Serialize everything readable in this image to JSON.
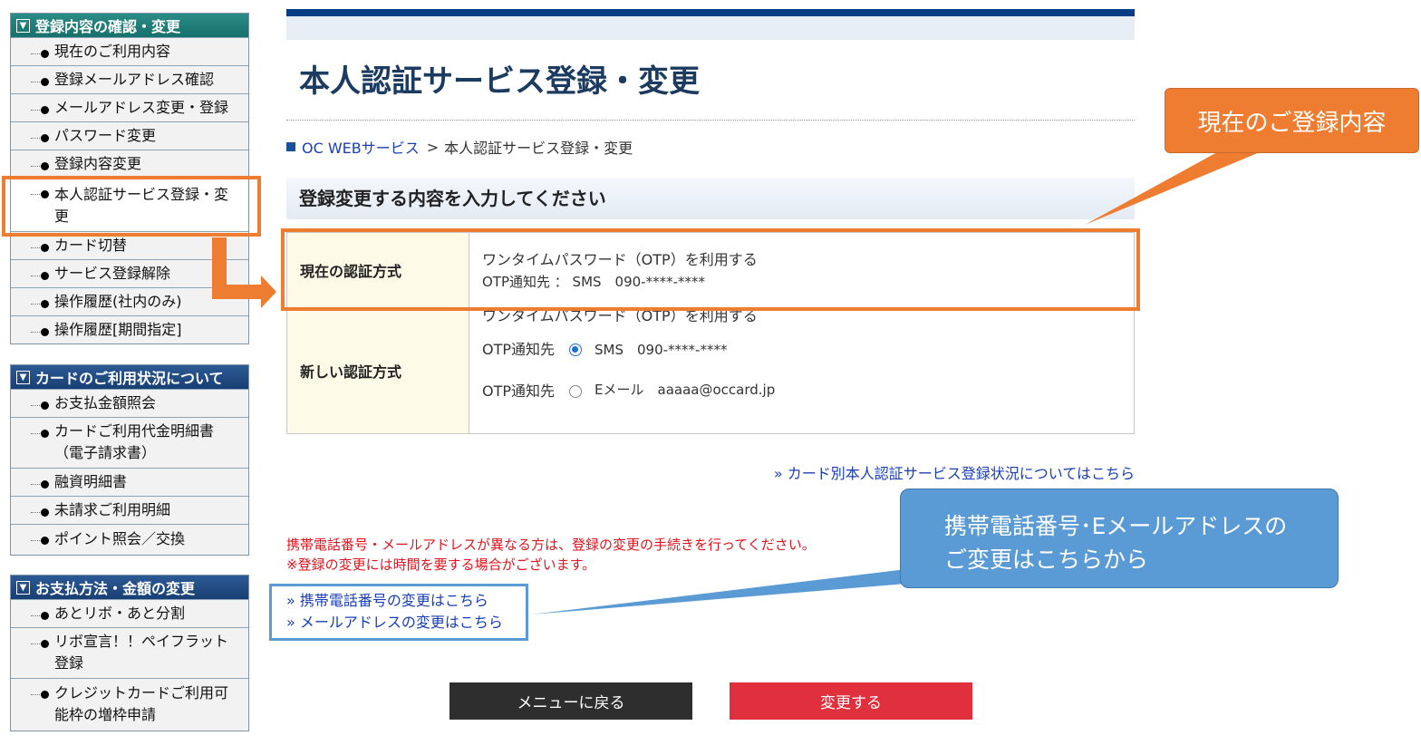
{
  "sidebar": {
    "menus": [
      {
        "title": "登録内容の確認・変更",
        "items": [
          "現在のご利用内容",
          "登録メールアドレス確認",
          "メールアドレス変更・登録",
          "パスワード変更",
          "登録内容変更",
          "本人認証サービス登録・変更",
          "カード切替",
          "サービス登録解除",
          "操作履歴(社内のみ)",
          "操作履歴[期間指定]"
        ]
      },
      {
        "title": "カードのご利用状況について",
        "items": [
          "お支払金額照会",
          "カードご利用代金明細書（電子請求書）",
          "融資明細書",
          "未請求ご利用明細",
          "ポイント照会／交換"
        ]
      },
      {
        "title": "お支払方法・金額の変更",
        "items": [
          "あとリボ・あと分割",
          "リボ宣言！！ペイフラット登録",
          "クレジットカードご利用可能枠の増枠申請"
        ]
      }
    ]
  },
  "main": {
    "title": "本人認証サービス登録・変更",
    "breadcrumb": {
      "root": "OC WEBサービス",
      "separator": ">",
      "current": "本人認証サービス登録・変更"
    },
    "section_title": "登録変更する内容を入力してください",
    "current_method": {
      "label": "現在の認証方式",
      "line1": "ワンタイムパスワード（OTP）を利用する",
      "line2": "OTP通知先 ： SMS　090-****-****"
    },
    "new_method": {
      "label": "新しい認証方式",
      "line1": "ワンタイムパスワード（OTP）を利用する",
      "option_label": "OTP通知先",
      "sms_text": "SMS　090-****-****",
      "email_text": "Eメール　aaaaa@occard.jp",
      "selected": "sms"
    },
    "card_status_link": "» カード別本人認証サービス登録状況についてはこちら",
    "notice_line1": "携帯電話番号・メールアドレスが異なる方は、登録の変更の手続きを行ってください。",
    "notice_line2": "※登録の変更には時間を要する場合がございます。",
    "phone_link": "» 携帯電話番号の変更はこちら",
    "email_link": "» メールアドレスの変更はこちら",
    "back_button": "メニューに戻る",
    "submit_button": "変更する"
  },
  "annotations": {
    "callout_current": "現在のご登録内容",
    "callout_contact_line1": "携帯電話番号･Eメールアドレスの",
    "callout_contact_line2": "ご変更はこちらから",
    "colors": {
      "orange": "#ee7d31",
      "blue": "#5b9bd5",
      "notice_red": "#e0141e",
      "submit_red": "#e0303e"
    }
  }
}
